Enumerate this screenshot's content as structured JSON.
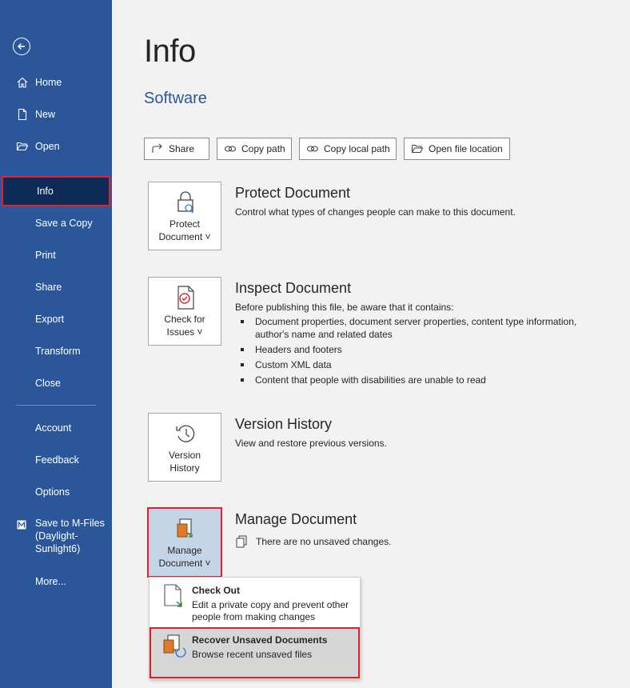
{
  "sidebar": {
    "items": [
      {
        "label": "Home",
        "icon": "home-icon"
      },
      {
        "label": "New",
        "icon": "new-document-icon"
      },
      {
        "label": "Open",
        "icon": "folder-open-icon"
      },
      {
        "label": "Info"
      },
      {
        "label": "Save a Copy"
      },
      {
        "label": "Print"
      },
      {
        "label": "Share"
      },
      {
        "label": "Export"
      },
      {
        "label": "Transform"
      },
      {
        "label": "Close"
      },
      {
        "label": "Account"
      },
      {
        "label": "Feedback"
      },
      {
        "label": "Options"
      },
      {
        "label": "Save to M-Files (Daylight-Sunlight6)",
        "icon": "mfiles-icon"
      },
      {
        "label": "More..."
      }
    ],
    "active": "Info"
  },
  "main": {
    "title": "Info",
    "document_name": "Software",
    "actions": [
      {
        "label": "Share",
        "icon": "share-icon"
      },
      {
        "label": "Copy path",
        "icon": "link-icon"
      },
      {
        "label": "Copy local path",
        "icon": "link-icon"
      },
      {
        "label": "Open file location",
        "icon": "folder-open-icon"
      }
    ],
    "sections": {
      "protect": {
        "button_line1": "Protect",
        "button_line2": "Document ˅",
        "title": "Protect Document",
        "description": "Control what types of changes people can make to this document."
      },
      "inspect": {
        "button_line1": "Check for",
        "button_line2": "Issues ˅",
        "title": "Inspect Document",
        "description": "Before publishing this file, be aware that it contains:",
        "bullets": [
          "Document properties, document server properties, content type information, author's name and related dates",
          "Headers and footers",
          "Custom XML data",
          "Content that people with disabilities are unable to read"
        ]
      },
      "version": {
        "button_line1": "Version",
        "button_line2": "History",
        "title": "Version History",
        "description": "View and restore previous versions."
      },
      "manage": {
        "button_line1": "Manage",
        "button_line2": "Document ˅",
        "title": "Manage Document",
        "description": "There are no unsaved changes."
      }
    },
    "manage_menu": [
      {
        "title": "Check Out",
        "description": "Edit a private copy and prevent other people from making changes"
      },
      {
        "title": "Recover Unsaved Documents",
        "description": "Browse recent unsaved files"
      }
    ]
  },
  "colors": {
    "sidebar": "#2b579a",
    "sidebar_active": "#0e2a57",
    "highlight_border": "#e0202f",
    "accent_text": "#2b579a"
  }
}
